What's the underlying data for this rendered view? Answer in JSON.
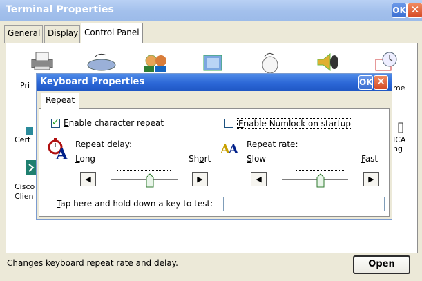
{
  "window": {
    "title": "Terminal Properties",
    "ok_label": "OK",
    "close_label": "✕"
  },
  "tabs": [
    {
      "label": "General"
    },
    {
      "label": "Display"
    },
    {
      "label": "Control Panel"
    }
  ],
  "control_panel": {
    "items": [
      {
        "label": "Pri",
        "icon": "printer-icon"
      },
      {
        "label": "",
        "icon": "mouse-icon"
      },
      {
        "label": "",
        "icon": "users-icon"
      },
      {
        "label": "",
        "icon": "network-icon"
      },
      {
        "label": "",
        "icon": "mouse-pointer-icon"
      },
      {
        "label": "",
        "icon": "speaker-icon"
      },
      {
        "label": "me",
        "icon": "clock-icon"
      },
      {
        "label": "Cert",
        "icon": "certificate-icon"
      },
      {
        "label": "ICA",
        "icon": "ica-icon"
      },
      {
        "label": "ng",
        "icon": ""
      },
      {
        "label": "Cisco",
        "icon": "cisco-icon"
      },
      {
        "label": "Clien",
        "icon": ""
      }
    ]
  },
  "status_text": "Changes keyboard repeat rate and delay.",
  "open_button": "Open",
  "dialog": {
    "title": "Keyboard Properties",
    "ok_label": "OK",
    "close_label": "✕",
    "tab": "Repeat",
    "enable_repeat": {
      "label_u": "E",
      "label_rest": "nable character repeat",
      "checked": true
    },
    "enable_numlock": {
      "label_u": "E",
      "label_rest": "nable Numlock on startup",
      "checked": false
    },
    "repeat_delay": {
      "label_pre": "Repeat ",
      "label_u": "d",
      "label_rest": "elay:",
      "min_u": "L",
      "min_rest": "ong",
      "max_pre": "Sh",
      "max_u": "o",
      "max_rest": "rt",
      "value": 0.6
    },
    "repeat_rate": {
      "label_u": "R",
      "label_rest": "epeat rate:",
      "min_u": "S",
      "min_rest": "low",
      "max_u": "F",
      "max_rest": "ast",
      "value": 0.6
    },
    "test_prompt_u": "T",
    "test_prompt_rest": "ap here and hold down a key to test:",
    "test_value": ""
  }
}
